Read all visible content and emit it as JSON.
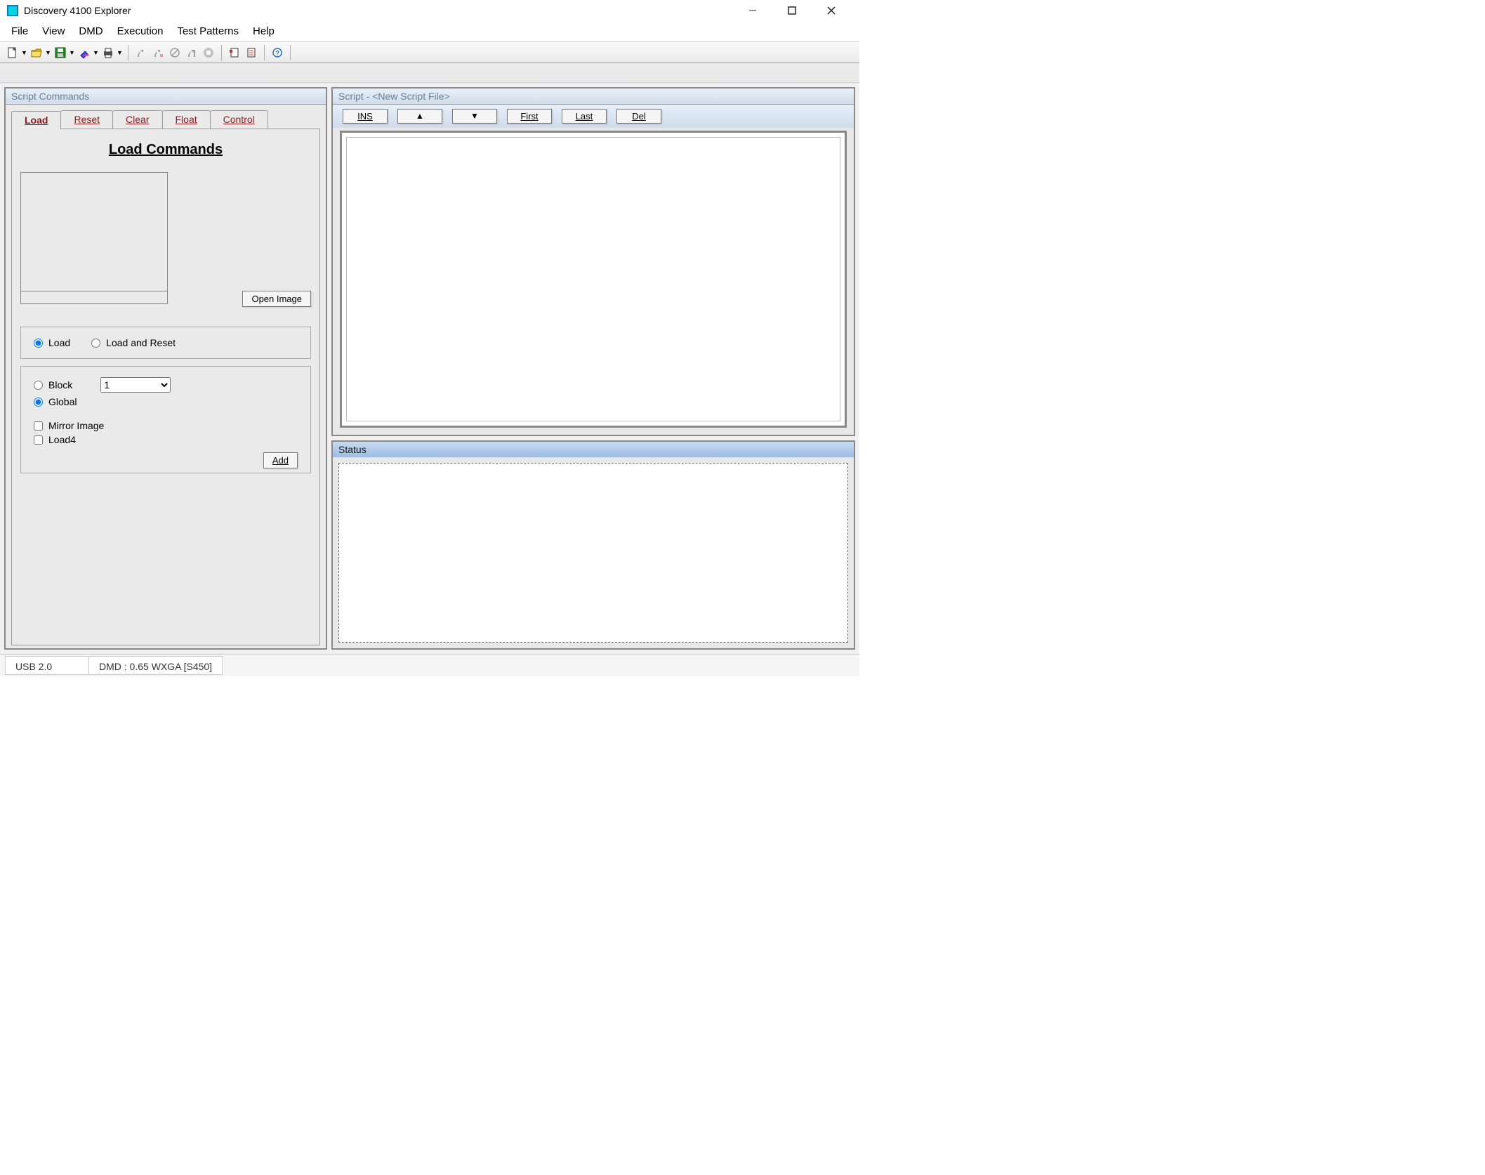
{
  "window": {
    "title": "Discovery 4100 Explorer"
  },
  "menu": [
    "File",
    "View",
    "DMD",
    "Execution",
    "Test Patterns",
    "Help"
  ],
  "left_panel": {
    "title": "Script Commands",
    "tabs": [
      "Load",
      "Reset",
      "Clear",
      "Float",
      "Control"
    ],
    "active": 0,
    "heading": "Load Commands",
    "open_image_btn": "Open Image",
    "radio_mode": {
      "load": "Load",
      "load_reset": "Load and Reset",
      "selected": "load"
    },
    "scope": {
      "block": "Block",
      "global": "Global",
      "selected": "global",
      "block_value": "1"
    },
    "checks": {
      "mirror": "Mirror Image",
      "load4": "Load4"
    },
    "add_btn": "Add"
  },
  "script_panel": {
    "title": "Script - <New Script File>",
    "buttons": {
      "ins": "INS",
      "up": "▲",
      "down": "▼",
      "first": "First",
      "last": "Last",
      "del": "Del"
    }
  },
  "status_panel": {
    "title": "Status"
  },
  "statusbar": {
    "usb": "USB 2.0",
    "dmd": "DMD : 0.65 WXGA [S450]"
  }
}
